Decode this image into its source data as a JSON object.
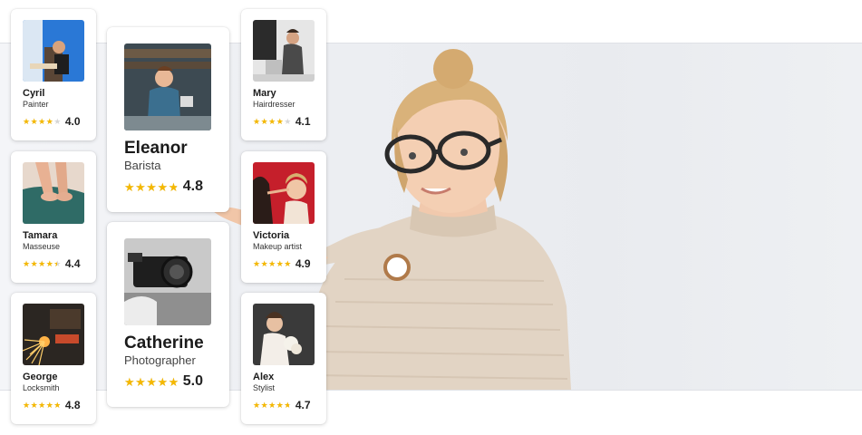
{
  "cards": [
    {
      "id": "cyril",
      "name": "Cyril",
      "role": "Painter",
      "rating": 4.0,
      "rating_text": "4.0",
      "photo": "painter-photo"
    },
    {
      "id": "tamara",
      "name": "Tamara",
      "role": "Masseuse",
      "rating": 4.4,
      "rating_text": "4.4",
      "photo": "masseuse-photo"
    },
    {
      "id": "george",
      "name": "George",
      "role": "Locksmith",
      "rating": 4.8,
      "rating_text": "4.8",
      "photo": "locksmith-photo"
    },
    {
      "id": "eleanor",
      "name": "Eleanor",
      "role": "Barista",
      "rating": 4.8,
      "rating_text": "4.8",
      "photo": "barista-photo"
    },
    {
      "id": "catherine",
      "name": "Catherine",
      "role": "Photographer",
      "rating": 5.0,
      "rating_text": "5.0",
      "photo": "photographer-photo"
    },
    {
      "id": "mary",
      "name": "Mary",
      "role": "Hairdresser",
      "rating": 4.1,
      "rating_text": "4.1",
      "photo": "hairdresser-photo"
    },
    {
      "id": "victoria",
      "name": "Victoria",
      "role": "Makeup artist",
      "rating": 4.9,
      "rating_text": "4.9",
      "photo": "makeup-artist-photo"
    },
    {
      "id": "alex",
      "name": "Alex",
      "role": "Stylist",
      "rating": 4.7,
      "rating_text": "4.7",
      "photo": "stylist-photo"
    }
  ],
  "star_glyphs": "★★★★★",
  "colors": {
    "star": "#f5b800",
    "star_empty": "#d6d6d6",
    "text": "#1b1b1b"
  },
  "hero": {
    "photo": "woman-pointing-photo"
  }
}
